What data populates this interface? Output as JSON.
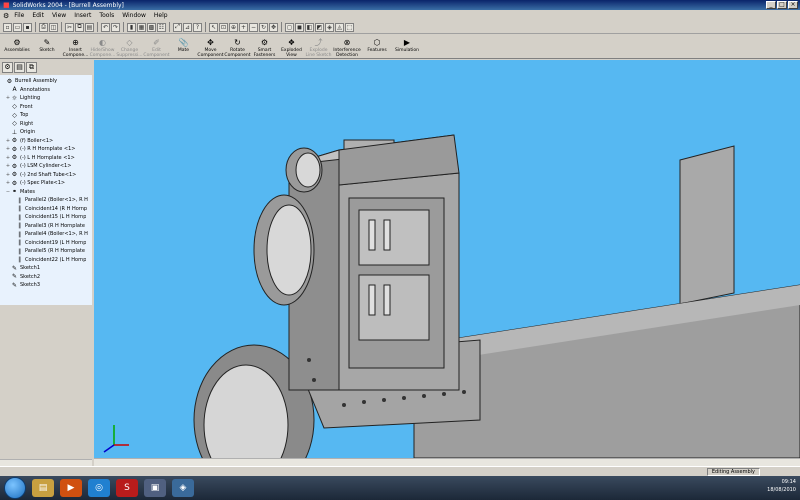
{
  "window": {
    "title": "SolidWorks 2004 - [Burrell Assembly]"
  },
  "menu": [
    "File",
    "Edit",
    "View",
    "Insert",
    "Tools",
    "Window",
    "Help"
  ],
  "commands": [
    {
      "l1": "Assemblies",
      "l2": "",
      "icon": "⚙",
      "dis": false
    },
    {
      "l1": "Sketch",
      "l2": "",
      "icon": "✎",
      "dis": false
    },
    {
      "l1": "Insert",
      "l2": "Compone...",
      "icon": "⊕",
      "dis": false
    },
    {
      "l1": "Hide/Show",
      "l2": "Compone...",
      "icon": "◐",
      "dis": true
    },
    {
      "l1": "Change",
      "l2": "Suppressi...",
      "icon": "◇",
      "dis": true
    },
    {
      "l1": "Edit",
      "l2": "Component",
      "icon": "✐",
      "dis": true
    },
    {
      "l1": "Mate",
      "l2": "",
      "icon": "📎",
      "dis": false
    },
    {
      "l1": "Move",
      "l2": "Component",
      "icon": "✥",
      "dis": false
    },
    {
      "l1": "Rotate",
      "l2": "Component",
      "icon": "↻",
      "dis": false
    },
    {
      "l1": "Smart",
      "l2": "Fasteners",
      "icon": "⚙",
      "dis": false
    },
    {
      "l1": "Exploded",
      "l2": "View",
      "icon": "❖",
      "dis": false
    },
    {
      "l1": "Explode",
      "l2": "Line Sketch",
      "icon": "⤴",
      "dis": true
    },
    {
      "l1": "Interference",
      "l2": "Detection",
      "icon": "⊗",
      "dis": false
    },
    {
      "l1": "Features",
      "l2": "",
      "icon": "⬡",
      "dis": false
    },
    {
      "l1": "Simulation",
      "l2": "",
      "icon": "▶",
      "dis": false
    }
  ],
  "tree": [
    {
      "label": "Burrell Assembly",
      "icon": "⚙",
      "exp": "",
      "indent": 0
    },
    {
      "label": "Annotations",
      "icon": "A",
      "exp": "",
      "indent": 1
    },
    {
      "label": "Lighting",
      "icon": "☼",
      "exp": "+",
      "indent": 1
    },
    {
      "label": "Front",
      "icon": "◇",
      "exp": "",
      "indent": 1
    },
    {
      "label": "Top",
      "icon": "◇",
      "exp": "",
      "indent": 1
    },
    {
      "label": "Right",
      "icon": "◇",
      "exp": "",
      "indent": 1
    },
    {
      "label": "Origin",
      "icon": "⊥",
      "exp": "",
      "indent": 1
    },
    {
      "label": "(f) Boiler<1>",
      "icon": "⚙",
      "exp": "+",
      "indent": 1
    },
    {
      "label": "(-) R H Hornplate <1>",
      "icon": "⚙",
      "exp": "+",
      "indent": 1
    },
    {
      "label": "(-) L H Hornplate <1>",
      "icon": "⚙",
      "exp": "+",
      "indent": 1
    },
    {
      "label": "(-) LSM Cylinder<1>",
      "icon": "⚙",
      "exp": "+",
      "indent": 1
    },
    {
      "label": "(-) 2nd Shaft Tube<1>",
      "icon": "⚙",
      "exp": "+",
      "indent": 1
    },
    {
      "label": "(-) Spec Plate<1>",
      "icon": "⚙",
      "exp": "+",
      "indent": 1
    },
    {
      "label": "Mates",
      "icon": "⚭",
      "exp": "−",
      "indent": 1
    },
    {
      "label": "Parallel2 (Boiler<1>, R H",
      "icon": "∥",
      "exp": "",
      "indent": 2
    },
    {
      "label": "Coincident14 (R H Hornp",
      "icon": "∥",
      "exp": "",
      "indent": 2
    },
    {
      "label": "Coincident15 (L H Hornp",
      "icon": "∥",
      "exp": "",
      "indent": 2
    },
    {
      "label": "Parallel3 (R H Hornplate",
      "icon": "∥",
      "exp": "",
      "indent": 2
    },
    {
      "label": "Parallel4 (Boiler<1>, R H",
      "icon": "∥",
      "exp": "",
      "indent": 2
    },
    {
      "label": "Coincident19 (L H Hornp",
      "icon": "∥",
      "exp": "",
      "indent": 2
    },
    {
      "label": "Parallel5 (R H Hornplate",
      "icon": "∥",
      "exp": "",
      "indent": 2
    },
    {
      "label": "Coincident22 (L H Hornp",
      "icon": "∥",
      "exp": "",
      "indent": 2
    },
    {
      "label": "Sketch1",
      "icon": "✎",
      "exp": "",
      "indent": 1
    },
    {
      "label": "Sketch2",
      "icon": "✎",
      "exp": "",
      "indent": 1
    },
    {
      "label": "Sketch3",
      "icon": "✎",
      "exp": "",
      "indent": 1
    }
  ],
  "status": {
    "mode": "Editing Assembly"
  },
  "tray": {
    "time": "09:14",
    "date": "18/08/2010"
  },
  "colors": {
    "viewport": "#56b8f2",
    "titlebar": "#0a246a",
    "model": "#9a9a9a"
  }
}
